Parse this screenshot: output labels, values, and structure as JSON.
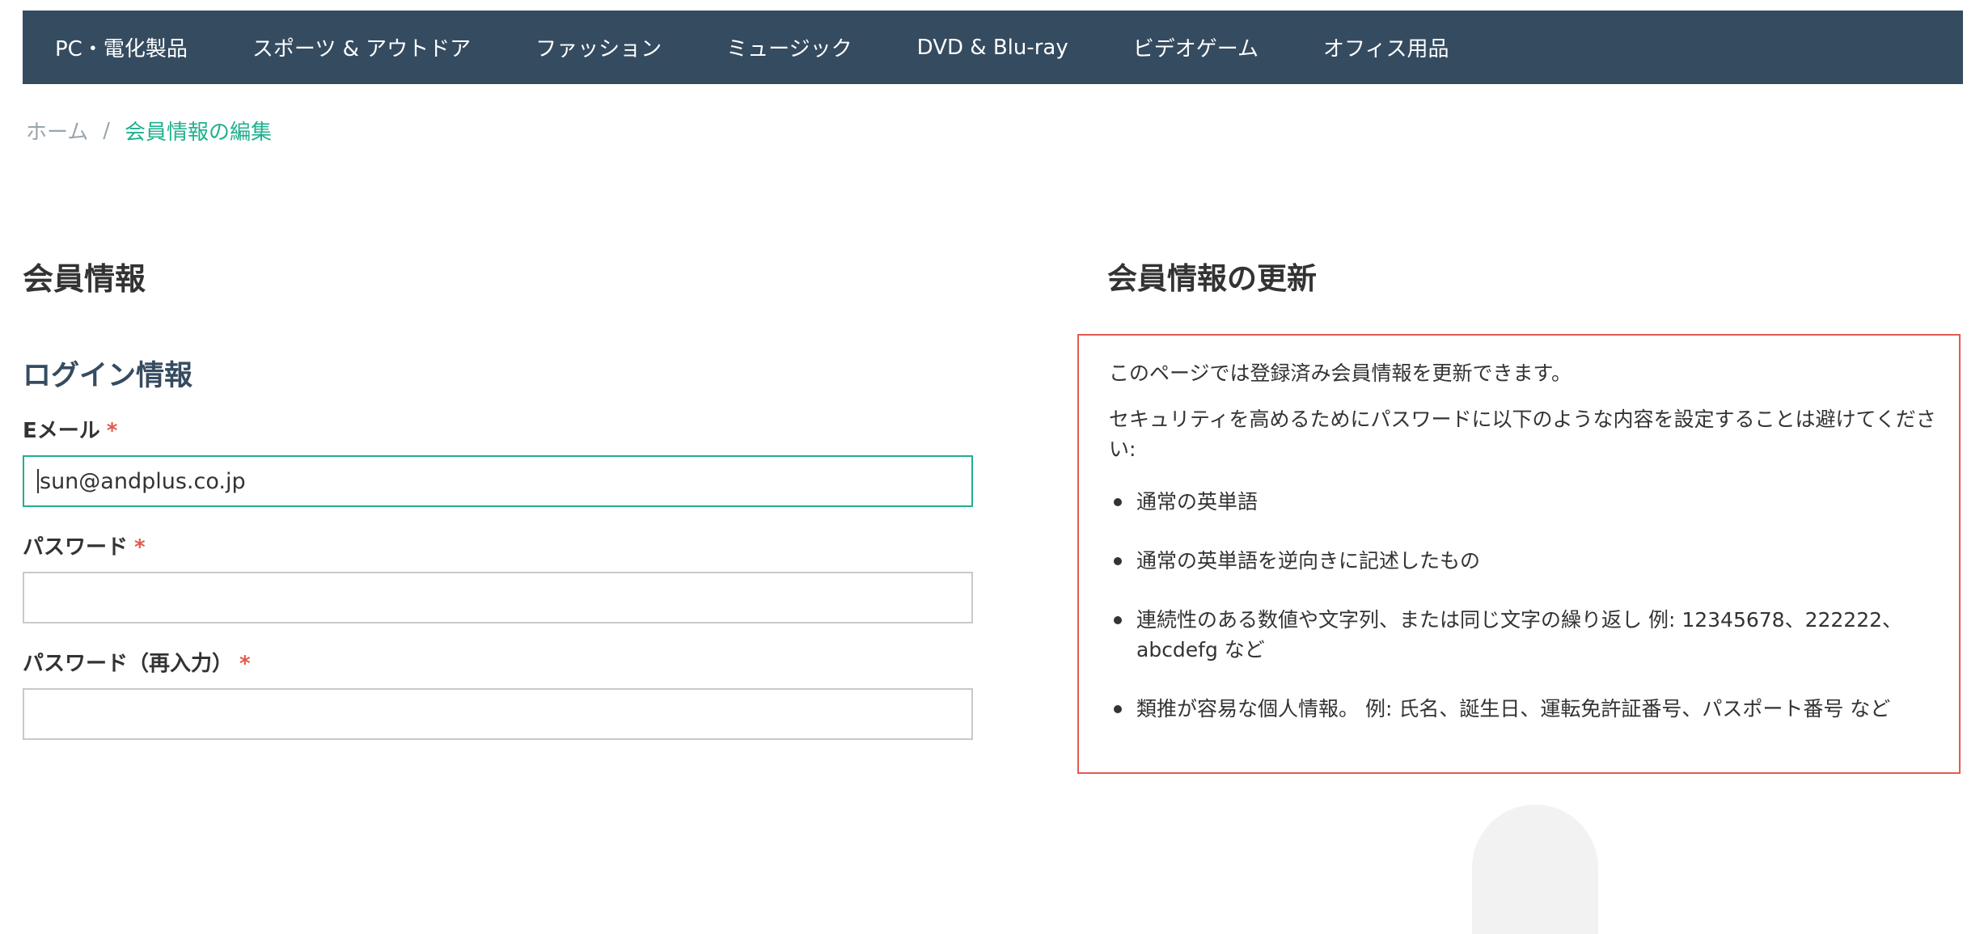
{
  "topnav": {
    "items": [
      {
        "label": "PC・電化製品"
      },
      {
        "label": "スポーツ & アウトドア"
      },
      {
        "label": "ファッション"
      },
      {
        "label": "ミュージック"
      },
      {
        "label": "DVD & Blu-ray"
      },
      {
        "label": "ビデオゲーム"
      },
      {
        "label": "オフィス用品"
      }
    ]
  },
  "breadcrumb": {
    "home": "ホーム",
    "separator": "/",
    "current": "会員情報の編集"
  },
  "form": {
    "page_title": "会員情報",
    "section_title": "ログイン情報",
    "required_mark": "*",
    "email": {
      "label": "Eメール",
      "value": "sun@andplus.co.jp"
    },
    "password": {
      "label": "パスワード",
      "value": ""
    },
    "password_confirm": {
      "label": "パスワード（再入力）",
      "value": ""
    }
  },
  "info": {
    "title": "会員情報の更新",
    "paragraphs": [
      "このページでは登録済み会員情報を更新できます。",
      "セキュリティを高めるためにパスワードに以下のような内容を設定することは避けてください:"
    ],
    "items": [
      "通常の英単語",
      "通常の英単語を逆向きに記述したもの",
      "連続性のある数値や文字列、または同じ文字の繰り返し 例: 12345678、222222、abcdefg など",
      "類推が容易な個人情報。 例: 氏名、誕生日、運転免許証番号、パスポート番号 など"
    ]
  },
  "colors": {
    "nav_bg": "#354b60",
    "accent_green": "#20b08e",
    "required_red": "#e05a4b",
    "info_border": "#e25a50"
  }
}
